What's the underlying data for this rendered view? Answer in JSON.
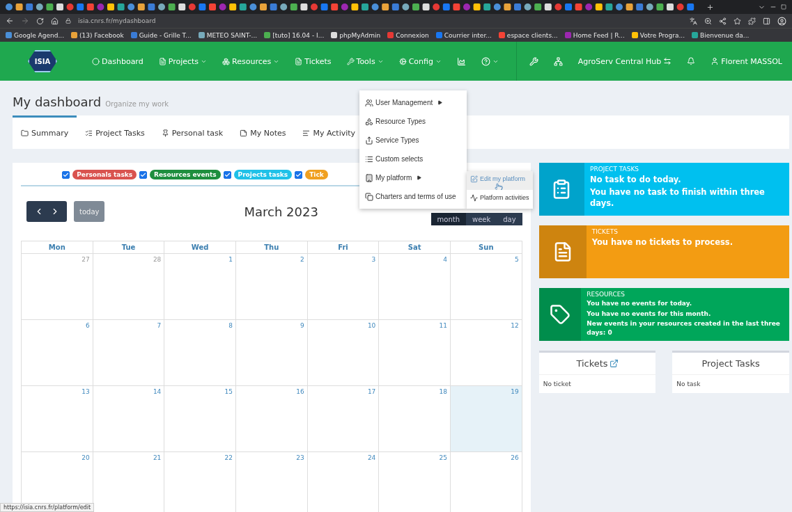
{
  "browser": {
    "url": "isia.cnrs.fr/mydashboard",
    "bookmarks": [
      "Google Agend...",
      "(13) Facebook",
      "Guide - Grille T...",
      "METEO SAINT-...",
      "[tuto] 16.04 - I...",
      "phpMyAdmin",
      "Connexion",
      "Courrier inter...",
      "espace clients...",
      "Home Feed | R...",
      "Votre Progra...",
      "Bienvenue da..."
    ],
    "status_url": "https://isia.cnrs.fr/platform/edit"
  },
  "navbar": {
    "logo": "ISIA",
    "items": [
      {
        "kind": "dashboard",
        "label": "Dashboard",
        "caret": false
      },
      {
        "kind": "projects",
        "label": "Projects",
        "caret": true
      },
      {
        "kind": "resources",
        "label": "Resources",
        "caret": true
      },
      {
        "kind": "tickets",
        "label": "Tickets",
        "caret": false
      },
      {
        "kind": "tools",
        "label": "Tools",
        "caret": true
      },
      {
        "kind": "config",
        "label": "Config",
        "caret": true
      },
      {
        "kind": "stats",
        "caret": false
      },
      {
        "kind": "help",
        "caret": true
      }
    ],
    "hub": "AgroServ Central Hub",
    "user": "Florent MASSOL"
  },
  "config_menu": {
    "items": [
      {
        "kind": "users",
        "label": "User Management",
        "submenu": true
      },
      {
        "kind": "resource-types",
        "label": "Resource Types",
        "submenu": false
      },
      {
        "kind": "service-types",
        "label": "Service Types",
        "submenu": false
      },
      {
        "kind": "selects",
        "label": "Custom selects",
        "submenu": false
      },
      {
        "kind": "platform",
        "label": "My platform",
        "submenu": true
      },
      {
        "kind": "charters",
        "label": "Charters and terms of use",
        "submenu": false
      }
    ],
    "submenu": [
      {
        "kind": "edit",
        "label": "Edit my platform",
        "selected": true
      },
      {
        "kind": "activities",
        "label": "Platform activities",
        "selected": false
      }
    ]
  },
  "page": {
    "title": "My dashboard",
    "subtitle": "Organize my work"
  },
  "tabs": [
    {
      "kind": "summary",
      "label": "Summary",
      "selected": true
    },
    {
      "kind": "project-tasks",
      "label": "Project Tasks",
      "selected": false
    },
    {
      "kind": "personal",
      "label": "Personal task",
      "selected": false
    },
    {
      "kind": "notes",
      "label": "My Notes",
      "selected": false
    },
    {
      "kind": "activity",
      "label": "My Activity",
      "selected": false
    }
  ],
  "calendar": {
    "filters": [
      {
        "label": "Personals tasks",
        "checked": true,
        "color": "#d9534f"
      },
      {
        "label": "Resources events",
        "checked": true,
        "color": "#1e8e3e"
      },
      {
        "label": "Projects tasks",
        "checked": true,
        "color": "#1fc1e8"
      },
      {
        "label": "Tick",
        "checked": true,
        "color": "#f0a020"
      }
    ],
    "today_button": "today",
    "title": "March 2023",
    "views": [
      {
        "label": "month",
        "selected": true
      },
      {
        "label": "week",
        "selected": false
      },
      {
        "label": "day",
        "selected": false
      }
    ],
    "weekdays": [
      "Mon",
      "Tue",
      "Wed",
      "Thu",
      "Fri",
      "Sat",
      "Sun"
    ],
    "weeks": [
      [
        {
          "day": "27",
          "muted": true,
          "today": false
        },
        {
          "day": "28",
          "muted": true,
          "today": false
        },
        {
          "day": "1",
          "muted": false,
          "today": false
        },
        {
          "day": "2",
          "muted": false,
          "today": false
        },
        {
          "day": "3",
          "muted": false,
          "today": false
        },
        {
          "day": "4",
          "muted": false,
          "today": false
        },
        {
          "day": "5",
          "muted": false,
          "today": false
        }
      ],
      [
        {
          "day": "6",
          "muted": false,
          "today": false
        },
        {
          "day": "7",
          "muted": false,
          "today": false
        },
        {
          "day": "8",
          "muted": false,
          "today": false
        },
        {
          "day": "9",
          "muted": false,
          "today": false
        },
        {
          "day": "10",
          "muted": false,
          "today": false
        },
        {
          "day": "11",
          "muted": false,
          "today": false
        },
        {
          "day": "12",
          "muted": false,
          "today": false
        }
      ],
      [
        {
          "day": "13",
          "muted": false,
          "today": false
        },
        {
          "day": "14",
          "muted": false,
          "today": false
        },
        {
          "day": "15",
          "muted": false,
          "today": false
        },
        {
          "day": "16",
          "muted": false,
          "today": false
        },
        {
          "day": "17",
          "muted": false,
          "today": false
        },
        {
          "day": "18",
          "muted": false,
          "today": false
        },
        {
          "day": "19",
          "muted": false,
          "today": true
        }
      ],
      [
        {
          "day": "20",
          "muted": false,
          "today": false
        },
        {
          "day": "21",
          "muted": false,
          "today": false
        },
        {
          "day": "22",
          "muted": false,
          "today": false
        },
        {
          "day": "23",
          "muted": false,
          "today": false
        },
        {
          "day": "24",
          "muted": false,
          "today": false
        },
        {
          "day": "25",
          "muted": false,
          "today": false
        },
        {
          "day": "26",
          "muted": false,
          "today": false
        }
      ]
    ]
  },
  "info_boxes": [
    {
      "kind": "tasks",
      "title": "PROJECT TASKS",
      "color": "#00c0ef",
      "lines": [
        "No task to do today.",
        "You have no task to finish within three days."
      ]
    },
    {
      "kind": "tickets",
      "title": "TICKETS",
      "color": "#f39c12",
      "lines": [
        "You have no tickets to process."
      ]
    },
    {
      "kind": "resources",
      "title": "RESOURCES",
      "color": "#00a65a",
      "lines": [
        "You have no events for today.",
        "You have no events for this month.",
        "New events in your resources created in the last three days: 0"
      ]
    }
  ],
  "panels": [
    {
      "title": "Tickets",
      "link": true,
      "body": "No ticket"
    },
    {
      "title": "Project Tasks",
      "link": false,
      "body": "No task"
    }
  ]
}
